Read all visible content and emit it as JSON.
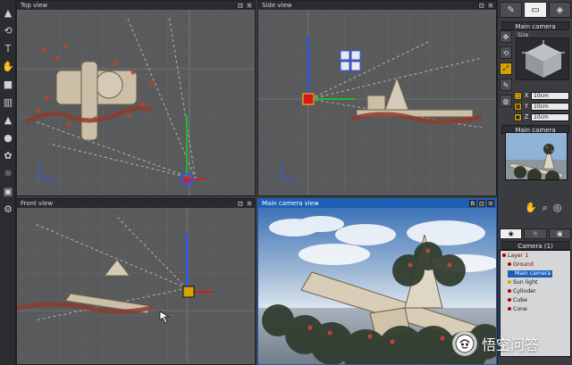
{
  "viewports": {
    "top": {
      "title": "Top view"
    },
    "side": {
      "title": "Side view"
    },
    "front": {
      "title": "Front view"
    },
    "main": {
      "title": "Main camera view"
    }
  },
  "right_panel": {
    "camera_header": "Main camera",
    "size_label": "Size",
    "coords": [
      {
        "axis": "X",
        "value": "10cm"
      },
      {
        "axis": "Y",
        "value": "10cm"
      },
      {
        "axis": "Z",
        "value": "10cm"
      }
    ],
    "preview_header": "Main camera",
    "object_list_header": "Camera (1)",
    "tree_items": [
      {
        "label": "Layer 1",
        "selected": false
      },
      {
        "label": "Ground",
        "selected": false
      },
      {
        "label": "Main camera",
        "selected": true
      },
      {
        "label": "Sun light",
        "selected": false
      },
      {
        "label": "Cylinder",
        "selected": false
      },
      {
        "label": "Cube",
        "selected": false
      },
      {
        "label": "Cone",
        "selected": false
      }
    ]
  },
  "watermark": {
    "text": "悟空问答"
  },
  "colors": {
    "viewport_bg": "#585a5c",
    "active_title": "#1f5fb6",
    "accent_yellow": "#d7a300",
    "axis_red": "#d61a1a",
    "axis_green": "#1dbb2b",
    "axis_blue": "#2b57ff"
  },
  "icons": {
    "left_toolbar": [
      "pointer-icon",
      "rotate-icon",
      "text-icon",
      "hand-icon",
      "cube-icon",
      "cylinder-icon",
      "cone-icon",
      "sphere-icon",
      "plant-icon",
      "light-icon",
      "camera-icon",
      "settings-icon"
    ],
    "right_side": [
      "move-icon",
      "rotate-icon",
      "scale-icon",
      "edit-icon",
      "paint-icon"
    ],
    "nav": [
      "hand-icon",
      "zoom-icon",
      "target-icon"
    ]
  }
}
